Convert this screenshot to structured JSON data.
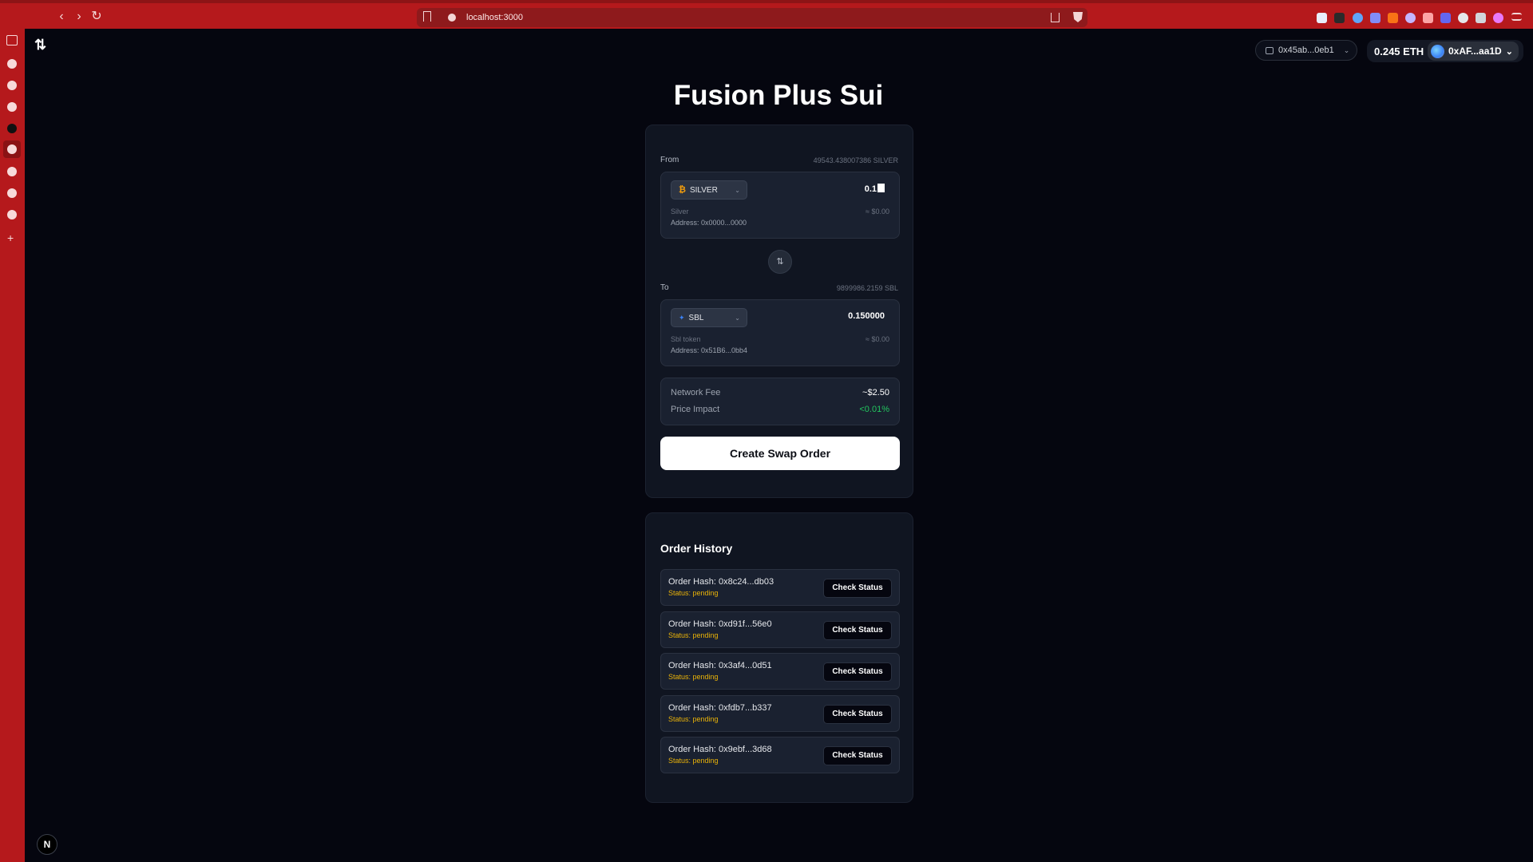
{
  "browser": {
    "url": "localhost:3000",
    "back_symbol": "‹",
    "forward_symbol": "›",
    "reload_symbol": "↻"
  },
  "header": {
    "logo_symbol": "⇅",
    "network_label": "0x45ab...0eb1",
    "eth_balance": "0.245 ETH",
    "account": "0xAF...aa1D"
  },
  "page": {
    "title": "Fusion Plus Sui"
  },
  "swap": {
    "from": {
      "label": "From",
      "balance": "49543.438007386 SILVER",
      "token_symbol": "SILVER",
      "token_icon": "₿",
      "amount": "0.1",
      "token_name": "Silver",
      "usd_value": "≈ $0.00",
      "address": "Address: 0x0000...0000"
    },
    "swap_icon": "⇅",
    "to": {
      "label": "To",
      "balance": "9899986.2159 SBL",
      "token_symbol": "SBL",
      "token_icon": "✦",
      "amount": "0.150000",
      "token_name": "Sbl token",
      "usd_value": "≈ $0.00",
      "address": "Address: 0x51B6...0bb4"
    },
    "fees": {
      "network_fee_label": "Network Fee",
      "network_fee_value": "~$2.50",
      "price_impact_label": "Price Impact",
      "price_impact_value": "<0.01%"
    },
    "create_button": "Create Swap Order"
  },
  "history": {
    "title": "Order History",
    "check_label": "Check Status",
    "orders": [
      {
        "hash": "Order Hash: 0x8c24...db03",
        "status": "Status: pending"
      },
      {
        "hash": "Order Hash: 0xd91f...56e0",
        "status": "Status: pending"
      },
      {
        "hash": "Order Hash: 0x3af4...0d51",
        "status": "Status: pending"
      },
      {
        "hash": "Order Hash: 0xfdb7...b337",
        "status": "Status: pending"
      },
      {
        "hash": "Order Hash: 0x9ebf...3d68",
        "status": "Status: pending"
      }
    ]
  },
  "dev_badge": "N",
  "colors": {
    "browser_chrome": "#b5191c",
    "page_bg": "#05060f",
    "status_pending": "#eab308",
    "price_impact": "#22c55e"
  }
}
